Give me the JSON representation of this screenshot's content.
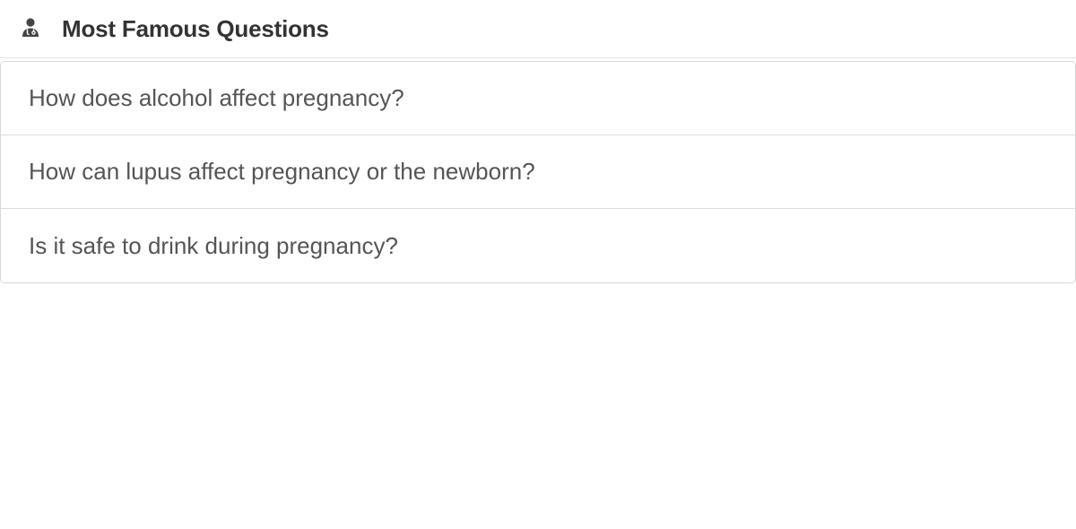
{
  "header": {
    "icon": "doctor-icon",
    "title": "Most Famous Questions"
  },
  "questions": [
    {
      "text": "How does alcohol affect pregnancy?"
    },
    {
      "text": "How can lupus affect pregnancy or the newborn?"
    },
    {
      "text": "Is it safe to drink during pregnancy?"
    }
  ]
}
